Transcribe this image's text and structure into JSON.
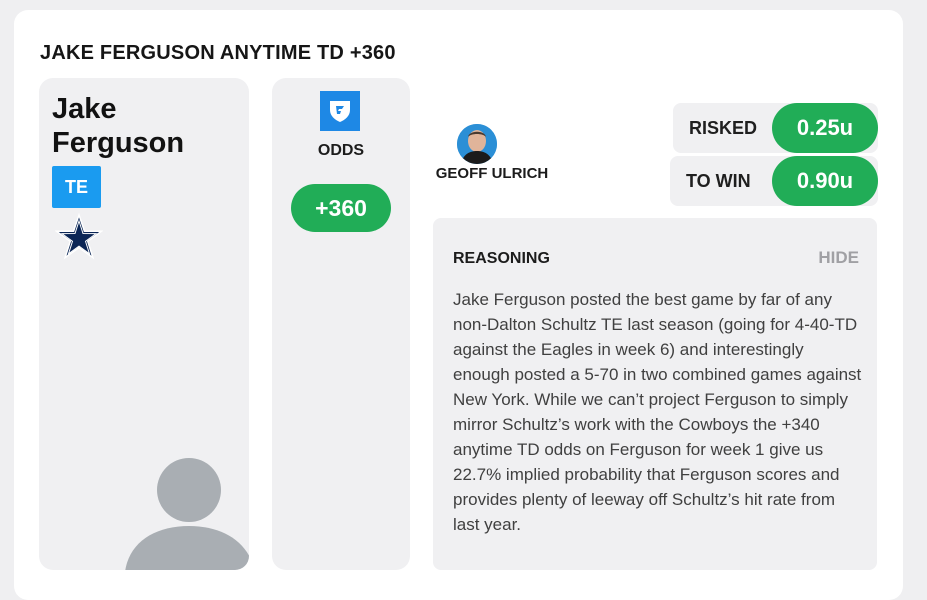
{
  "pick": {
    "title": "JAKE FERGUSON ANYTIME TD +360"
  },
  "player": {
    "name": "Jake Ferguson",
    "position": "TE",
    "team_logo_icon": "cowboys-star-icon",
    "avatar_icon": "person-silhouette-icon"
  },
  "odds": {
    "book_icon": "fanduel-shield-icon",
    "label": "ODDS",
    "value": "+360"
  },
  "capper": {
    "name": "GEOFF ULRICH"
  },
  "stake": {
    "risked_label": "RISKED",
    "risked_value": "0.25u",
    "to_win_label": "TO WIN",
    "to_win_value": "0.90u"
  },
  "reasoning": {
    "heading": "REASONING",
    "hide_label": "HIDE",
    "text": "Jake Ferguson posted the best game by far of any non-Dalton Schultz TE last season (going for 4-40-TD against the Eagles in week 6) and interestingly enough posted a 5-70 in two combined games against New York. While we can’t project Ferguson to simply mirror Schultz’s work with the Cowboys the +340 anytime TD odds on Ferguson for week 1 give us 22.7% implied probability that Ferguson scores and provides plenty of leeway off Schultz’s hit rate from last year."
  },
  "colors": {
    "accent_green": "#21ad57",
    "position_blue": "#1a9bf0",
    "book_blue": "#1e88e5",
    "cowboys_navy": "#0b2656",
    "panel_gray": "#f0f0f2"
  }
}
